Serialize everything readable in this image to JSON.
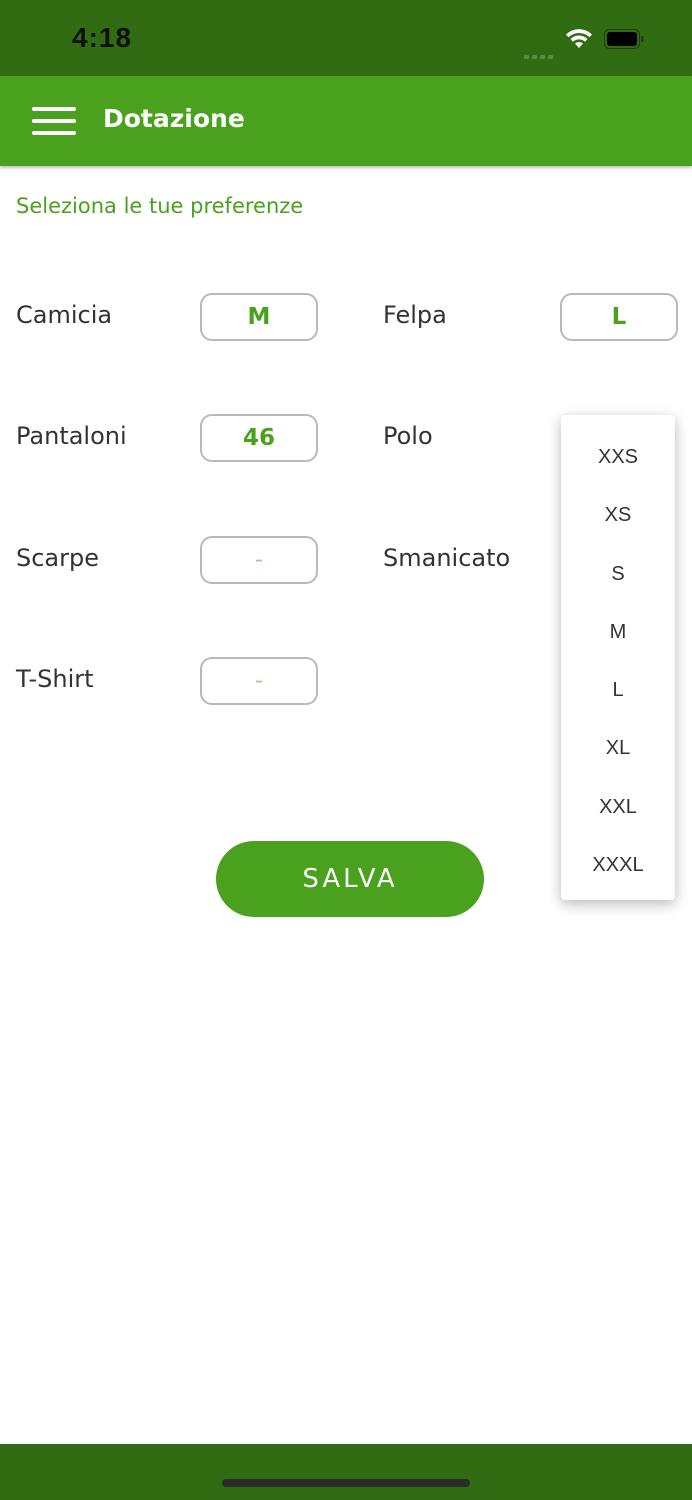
{
  "status_bar": {
    "time": "4:18",
    "signal_icon": "cellular-signal-icon",
    "wifi_icon": "wifi-icon",
    "battery_icon": "battery-icon"
  },
  "app_bar": {
    "menu_icon": "hamburger-menu-icon",
    "title": "Dotazione"
  },
  "subtitle": "Seleziona le tue preferenze",
  "fields": {
    "camicia": {
      "label": "Camicia",
      "value": "M"
    },
    "felpa": {
      "label": "Felpa",
      "value": "L"
    },
    "pantaloni": {
      "label": "Pantaloni",
      "value": "46"
    },
    "polo": {
      "label": "Polo",
      "value": ""
    },
    "scarpe": {
      "label": "Scarpe",
      "value": "-"
    },
    "smanicato": {
      "label": "Smanicato",
      "value": ""
    },
    "tshirt": {
      "label": "T-Shirt",
      "value": "-"
    }
  },
  "save_label": "SALVA",
  "dropdown": {
    "options": [
      "XXS",
      "XS",
      "S",
      "M",
      "L",
      "XL",
      "XXL",
      "XXXL"
    ]
  },
  "colors": {
    "primary": "#4aa11e",
    "status_bar": "#316b12",
    "empty_value": "#a4d28b"
  }
}
